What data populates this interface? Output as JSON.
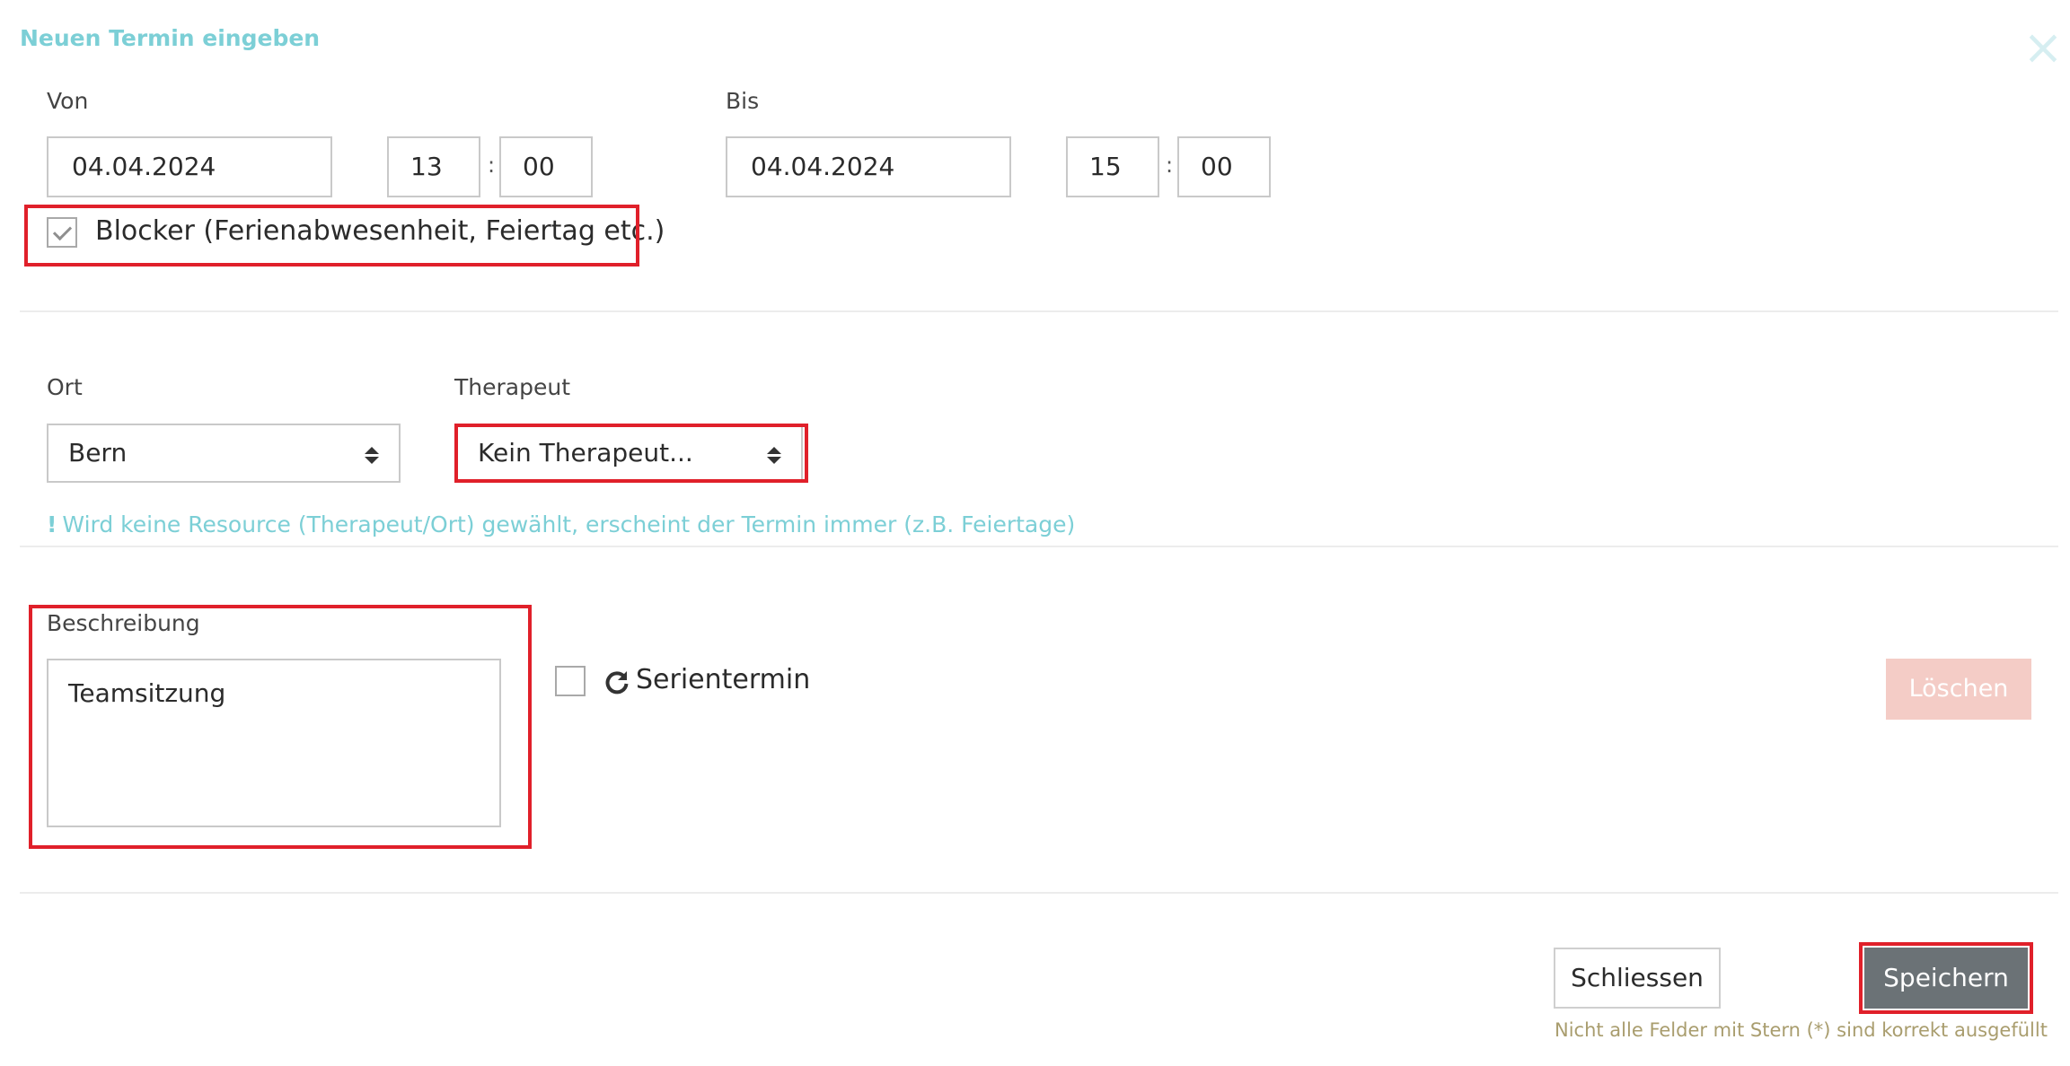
{
  "dialog": {
    "title": "Neuen Termin eingeben",
    "close_icon": "close-icon"
  },
  "von": {
    "label": "Von",
    "date": "04.04.2024",
    "hour": "13",
    "minute": "00",
    "separator": ":"
  },
  "bis": {
    "label": "Bis",
    "date": "04.04.2024",
    "hour": "15",
    "minute": "00",
    "separator": ":"
  },
  "blocker": {
    "label": "Blocker (Ferienabwesenheit, Feiertag etc.)",
    "checked": true
  },
  "ort": {
    "label": "Ort",
    "selected": "Bern"
  },
  "therapeut": {
    "label": "Therapeut",
    "selected": "Kein Therapeut..."
  },
  "hint": {
    "icon": "!",
    "text": "Wird keine Resource (Therapeut/Ort) gewählt, erscheint der Termin immer (z.B. Feiertage)"
  },
  "beschreibung": {
    "label": "Beschreibung",
    "value": "Teamsitzung"
  },
  "serientermin": {
    "label": "Serientermin",
    "checked": false,
    "icon": "refresh-icon"
  },
  "actions": {
    "delete_label": "Löschen",
    "close_label": "Schliessen",
    "save_label": "Speichern"
  },
  "footnote": "Nicht alle Felder mit Stern (*) sind korrekt ausgefüllt",
  "colors": {
    "accent": "#7ccfd6",
    "highlight": "#e0202a",
    "delete_bg": "#f4ccc6",
    "save_bg": "#6b7276",
    "footnote": "#a99d6e"
  }
}
